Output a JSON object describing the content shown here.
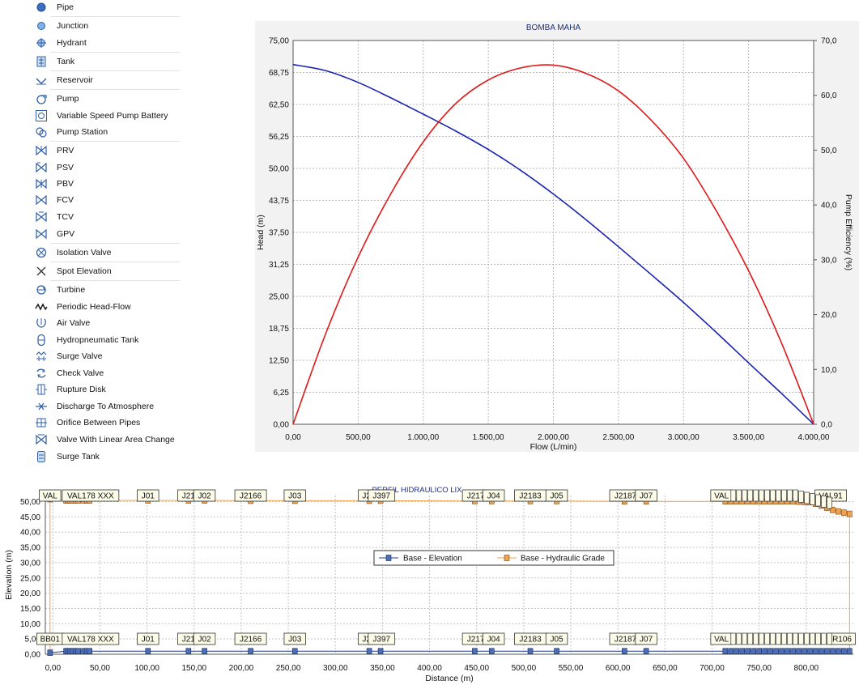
{
  "palette": {
    "items": [
      {
        "label": "Pipe",
        "icon": "pipe-icon"
      },
      {
        "label": "Junction",
        "icon": "junction-icon"
      },
      {
        "label": "Hydrant",
        "icon": "hydrant-icon"
      },
      {
        "label": "Tank",
        "icon": "tank-icon"
      },
      {
        "label": "Reservoir",
        "icon": "reservoir-icon"
      },
      {
        "label": "Pump",
        "icon": "pump-icon"
      },
      {
        "label": "Variable Speed Pump Battery",
        "icon": "pump-battery-icon"
      },
      {
        "label": "Pump Station",
        "icon": "pump-station-icon"
      },
      {
        "label": "PRV",
        "icon": "prv-icon"
      },
      {
        "label": "PSV",
        "icon": "psv-icon"
      },
      {
        "label": "PBV",
        "icon": "pbv-icon"
      },
      {
        "label": "FCV",
        "icon": "fcv-icon"
      },
      {
        "label": "TCV",
        "icon": "tcv-icon"
      },
      {
        "label": "GPV",
        "icon": "gpv-icon"
      },
      {
        "label": "Isolation Valve",
        "icon": "isolation-valve-icon"
      },
      {
        "label": "Spot Elevation",
        "icon": "spot-elevation-icon"
      },
      {
        "label": "Turbine",
        "icon": "turbine-icon"
      },
      {
        "label": "Periodic Head-Flow",
        "icon": "periodic-head-flow-icon"
      },
      {
        "label": "Air Valve",
        "icon": "air-valve-icon"
      },
      {
        "label": "Hydropneumatic Tank",
        "icon": "hydropneumatic-tank-icon"
      },
      {
        "label": "Surge Valve",
        "icon": "surge-valve-icon"
      },
      {
        "label": "Check Valve",
        "icon": "check-valve-icon"
      },
      {
        "label": "Rupture Disk",
        "icon": "rupture-disk-icon"
      },
      {
        "label": "Discharge To Atmosphere",
        "icon": "discharge-icon"
      },
      {
        "label": "Orifice Between Pipes",
        "icon": "orifice-icon"
      },
      {
        "label": "Valve With Linear Area Change",
        "icon": "linear-valve-icon"
      },
      {
        "label": "Surge Tank",
        "icon": "surge-tank-icon"
      }
    ]
  },
  "colors": {
    "head_curve": "#1a23b0",
    "efficiency_curve": "#e01818",
    "elevation_series": "#1f3f8f",
    "hgl_series": "#f0a050",
    "icon_blue": "#3a6fc4"
  },
  "chart_data": [
    {
      "type": "line",
      "title": "BOMBA MAHA",
      "xlabel": "Flow (L/min)",
      "ylabel": "Head (m)",
      "y2label": "Pump Efficiency (%)",
      "xlim": [
        0,
        4000
      ],
      "ylim": [
        0,
        75
      ],
      "y2lim": [
        0,
        70
      ],
      "x_ticks": [
        "0,00",
        "500,00",
        "1.000,00",
        "1.500,00",
        "2.000,00",
        "2.500,00",
        "3.000,00",
        "3.500,00",
        "4.000,00"
      ],
      "y_ticks": [
        "0,00",
        "6,25",
        "12,50",
        "18,75",
        "25,00",
        "31,25",
        "37,50",
        "43,75",
        "50,00",
        "56,25",
        "62,50",
        "68,75",
        "75,00"
      ],
      "y2_ticks": [
        "0,0",
        "10,0",
        "20,0",
        "30,0",
        "40,0",
        "50,0",
        "60,0",
        "70,0"
      ],
      "grid": true,
      "series": [
        {
          "axis": "left",
          "x": [
            0,
            250,
            500,
            750,
            1000,
            1250,
            1500,
            1750,
            2000,
            2250,
            2500,
            2750,
            3000,
            3250,
            3500,
            3750,
            4000
          ],
          "values": [
            70.3,
            69.1,
            66.8,
            63.8,
            60.6,
            57.3,
            53.7,
            49.6,
            45.0,
            40.0,
            34.7,
            29.3,
            23.8,
            18.0,
            12.0,
            6.1,
            0.0
          ]
        },
        {
          "axis": "right",
          "x": [
            0,
            250,
            500,
            750,
            1000,
            1250,
            1500,
            1750,
            2000,
            2250,
            2500,
            2750,
            3000,
            3250,
            3500,
            3750,
            4000
          ],
          "values": [
            0,
            16.5,
            30.5,
            42.0,
            51.5,
            58.5,
            62.8,
            65.0,
            65.5,
            64.0,
            60.8,
            55.5,
            48.5,
            39.0,
            28.0,
            15.0,
            0
          ]
        }
      ]
    },
    {
      "type": "line",
      "title": "PERFIL HIDRAULICO LIX",
      "xlabel": "Distance (m)",
      "ylabel": "Elevation (m)",
      "xlim": [
        -8,
        850
      ],
      "ylim": [
        0,
        52
      ],
      "x_ticks": [
        "0,00",
        "50,00",
        "100,00",
        "150,00",
        "200,00",
        "250,00",
        "300,00",
        "350,00",
        "400,00",
        "450,00",
        "500,00",
        "550,00",
        "600,00",
        "650,00",
        "700,00",
        "750,00",
        "800,00"
      ],
      "y_ticks": [
        "0,00",
        "5,00",
        "10,00",
        "15,00",
        "20,00",
        "25,00",
        "30,00",
        "35,00",
        "40,00",
        "45,00",
        "50,00"
      ],
      "grid": true,
      "legend": {
        "placement": "center",
        "entries": [
          "Base - Elevation",
          "Base - Hydraulic Grade"
        ]
      },
      "series": [
        {
          "name": "Base - Elevation",
          "x": [
            -3,
            14,
            16,
            18,
            21,
            24,
            27,
            33,
            36,
            39,
            101,
            144,
            161,
            210,
            257,
            336,
            348,
            448,
            466,
            507,
            535,
            607,
            630,
            714,
            720,
            726,
            732,
            738,
            744,
            750,
            756,
            762,
            768,
            774,
            780,
            786,
            792,
            798,
            804,
            810,
            816,
            822,
            828,
            834,
            840,
            846
          ],
          "values": [
            0.5,
            1.0,
            1.0,
            1.0,
            1.0,
            1.0,
            1.0,
            1.0,
            1.0,
            1.0,
            1.0,
            1.0,
            1.0,
            1.0,
            1.0,
            1.0,
            1.0,
            1.0,
            1.0,
            1.0,
            1.0,
            1.0,
            1.0,
            1.0,
            1.0,
            1.0,
            1.0,
            1.0,
            1.0,
            1.0,
            1.0,
            1.0,
            1.0,
            1.0,
            1.0,
            1.0,
            1.0,
            1.0,
            1.0,
            1.0,
            1.0,
            1.0,
            1.0,
            1.0,
            1.0,
            1.0
          ]
        },
        {
          "name": "Base - Hydraulic Grade",
          "x": [
            -3,
            14,
            16,
            18,
            21,
            24,
            27,
            33,
            36,
            39,
            101,
            144,
            161,
            210,
            257,
            336,
            348,
            448,
            466,
            507,
            535,
            607,
            630,
            714,
            720,
            726,
            732,
            738,
            744,
            750,
            756,
            762,
            768,
            774,
            780,
            786,
            792,
            798,
            804,
            810,
            816,
            822,
            828,
            834,
            840,
            846
          ],
          "values": [
            50.8,
            50.4,
            50.4,
            50.4,
            50.4,
            50.4,
            50.4,
            50.4,
            50.4,
            50.4,
            50.4,
            50.4,
            50.4,
            50.3,
            50.3,
            50.3,
            50.3,
            50.2,
            50.2,
            50.2,
            50.2,
            50.1,
            50.1,
            50.1,
            50.1,
            50.1,
            50.1,
            50.1,
            50.1,
            50.1,
            50.1,
            50.1,
            50.1,
            50.1,
            50.1,
            50.1,
            50.0,
            49.9,
            49.8,
            49.3,
            48.7,
            48.0,
            47.3,
            46.8,
            46.4,
            46.0
          ]
        }
      ],
      "labels_top": [
        {
          "text": "VAL",
          "x": -3
        },
        {
          "text": "VAL178 XXX",
          "x": 40
        },
        {
          "text": "J01",
          "x": 101
        },
        {
          "text": "J21",
          "x": 144
        },
        {
          "text": "J02",
          "x": 161
        },
        {
          "text": "J2166",
          "x": 210
        },
        {
          "text": "J03",
          "x": 257
        },
        {
          "text": "J2",
          "x": 333
        },
        {
          "text": "J397",
          "x": 349
        },
        {
          "text": "J217",
          "x": 449
        },
        {
          "text": "J04",
          "x": 468
        },
        {
          "text": "J2183",
          "x": 507
        },
        {
          "text": "J05",
          "x": 535
        },
        {
          "text": "J2187",
          "x": 608
        },
        {
          "text": "J07",
          "x": 630
        },
        {
          "text": "VAL",
          "x": 710
        },
        {
          "text": "VAL91",
          "x": 826
        }
      ],
      "labels_bottom": [
        {
          "text": "BB01",
          "x": -3
        },
        {
          "text": "VAL178 XXX",
          "x": 40
        },
        {
          "text": "J01",
          "x": 101
        },
        {
          "text": "J21",
          "x": 144
        },
        {
          "text": "J02",
          "x": 161
        },
        {
          "text": "J2166",
          "x": 210
        },
        {
          "text": "J03",
          "x": 257
        },
        {
          "text": "J2",
          "x": 333
        },
        {
          "text": "J397",
          "x": 349
        },
        {
          "text": "J217",
          "x": 449
        },
        {
          "text": "J04",
          "x": 468
        },
        {
          "text": "J2183",
          "x": 507
        },
        {
          "text": "J05",
          "x": 535
        },
        {
          "text": "J2187",
          "x": 608
        },
        {
          "text": "J07",
          "x": 630
        },
        {
          "text": "VAL",
          "x": 710
        },
        {
          "text": "R106",
          "x": 838
        }
      ]
    }
  ]
}
